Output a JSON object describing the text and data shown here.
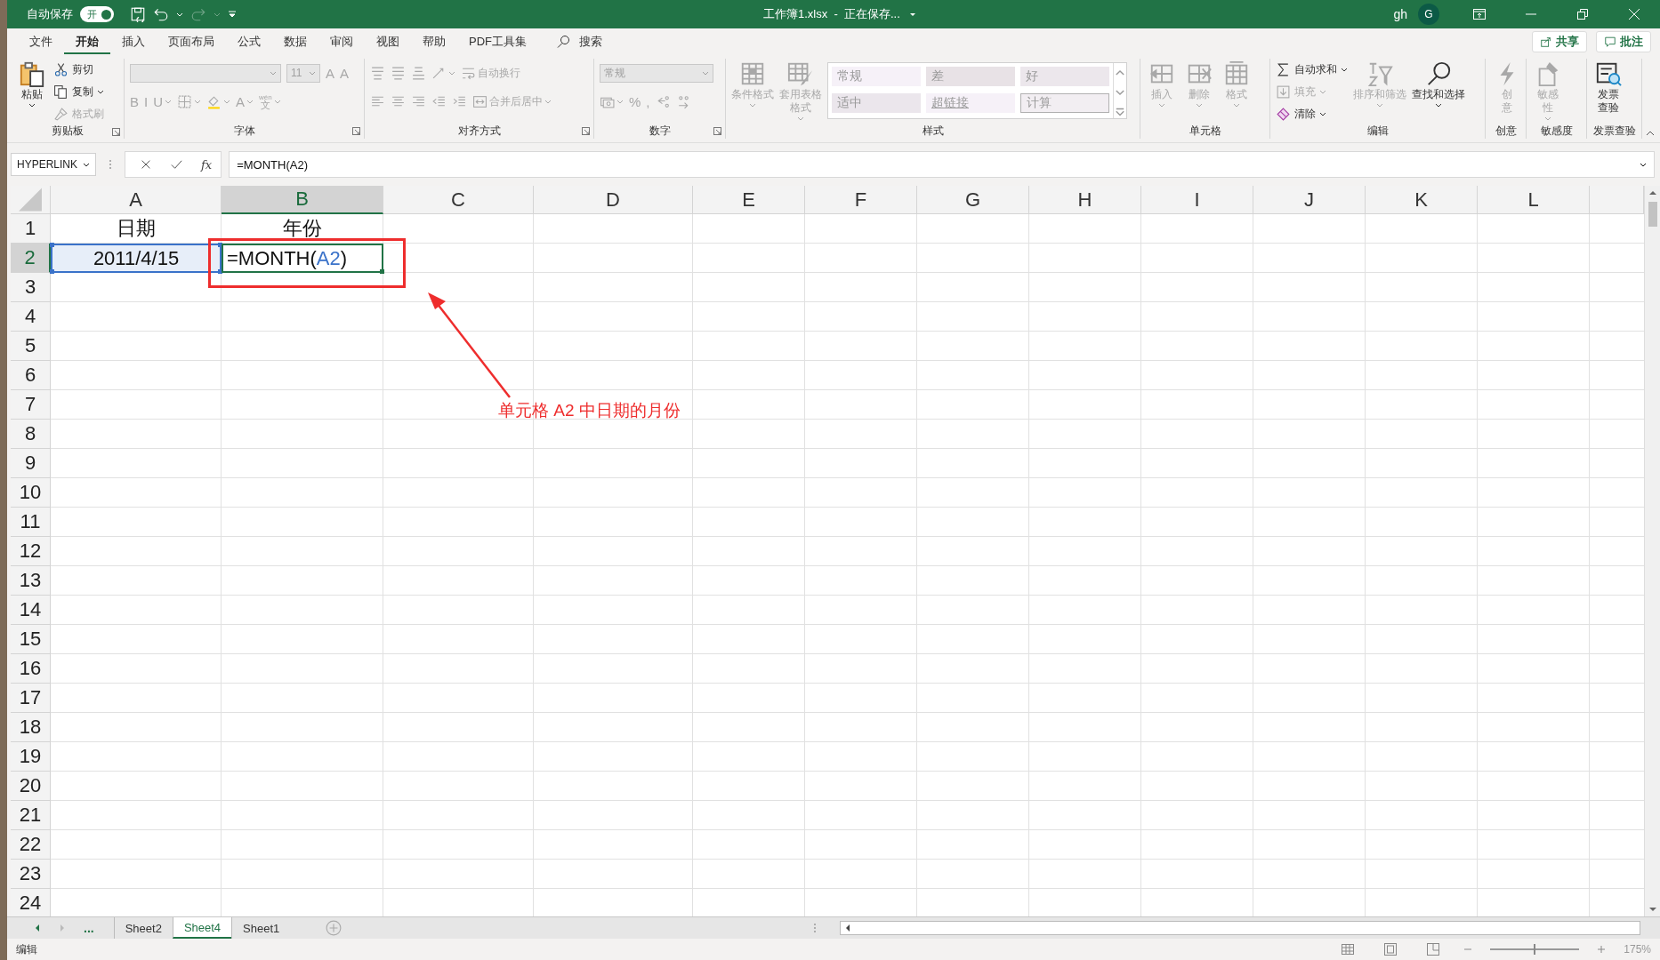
{
  "title_bar": {
    "autosave_label": "自动保存",
    "autosave_toggle": {
      "label": "开",
      "on": true
    },
    "redo_disabled": true,
    "title": "工作簿1.xlsx  -  正在保存...",
    "user": "gh",
    "avatar": "G"
  },
  "menu_tabs": [
    {
      "label": "文件",
      "selected": false
    },
    {
      "label": "开始",
      "selected": true
    },
    {
      "label": "插入",
      "selected": false
    },
    {
      "label": "页面布局",
      "selected": false
    },
    {
      "label": "公式",
      "selected": false
    },
    {
      "label": "数据",
      "selected": false
    },
    {
      "label": "审阅",
      "selected": false
    },
    {
      "label": "视图",
      "selected": false
    },
    {
      "label": "帮助",
      "selected": false
    },
    {
      "label": "PDF工具集",
      "selected": false
    }
  ],
  "search": {
    "label": "搜索"
  },
  "share_button": "共享",
  "comments_button": "批注",
  "ribbon": [
    {
      "label": "剪贴板",
      "launcher": true,
      "items": [
        {
          "kind": "large",
          "label": "粘贴",
          "disabled": false,
          "menu": true
        },
        {
          "kind": "stack",
          "rows": [
            {
              "kind": "button",
              "label": "剪切",
              "disabled": false,
              "menu": false
            },
            {
              "kind": "button",
              "label": "复制",
              "disabled": false,
              "menu": true
            },
            {
              "kind": "button",
              "label": "格式刷",
              "disabled": true,
              "menu": false
            }
          ]
        }
      ]
    },
    {
      "label": "字体",
      "launcher": true,
      "items": [
        {
          "kind": "stack",
          "rows": [
            {
              "kind": "tools",
              "tools": [
                {
                  "kind": "field",
                  "disabled": true
                },
                {
                  "kind": "field",
                  "value": "11",
                  "disabled": true
                },
                {
                  "kind": "text",
                  "text": "A",
                  "disabled": true,
                  "menu": false
                },
                {
                  "kind": "text",
                  "text": "A",
                  "disabled": true,
                  "menu": false
                }
              ]
            },
            {
              "kind": "tools",
              "tools": [
                {
                  "kind": "text",
                  "text": "B",
                  "disabled": true,
                  "menu": false
                },
                {
                  "kind": "text",
                  "text": "I",
                  "disabled": true,
                  "menu": false
                },
                {
                  "kind": "text",
                  "text": "U",
                  "disabled": true,
                  "menu": true
                },
                {
                  "kind": "icon",
                  "disabled": true,
                  "menu": true
                },
                {
                  "kind": "icon",
                  "disabled": true,
                  "menu": true
                },
                {
                  "kind": "text",
                  "text": "A",
                  "disabled": true,
                  "menu": true
                },
                {
                  "kind": "text",
                  "text": "文",
                  "ruby": "wén",
                  "disabled": true,
                  "menu": true
                }
              ]
            }
          ]
        }
      ]
    },
    {
      "label": "对齐方式",
      "launcher": true,
      "items": [
        {
          "kind": "stack",
          "rows": [
            {
              "kind": "tools",
              "tools": [
                {
                  "kind": "icon",
                  "disabled": true,
                  "menu": false
                },
                {
                  "kind": "icon",
                  "disabled": true,
                  "menu": false
                },
                {
                  "kind": "icon",
                  "disabled": true,
                  "menu": false
                },
                {
                  "kind": "icon",
                  "disabled": true,
                  "menu": true
                },
                {
                  "kind": "button",
                  "label": "自动换行",
                  "disabled": true,
                  "menu": false
                }
              ]
            },
            {
              "kind": "tools",
              "tools": [
                {
                  "kind": "icon",
                  "disabled": true,
                  "menu": false
                },
                {
                  "kind": "icon",
                  "disabled": true,
                  "menu": false
                },
                {
                  "kind": "icon",
                  "disabled": true,
                  "menu": false
                },
                {
                  "kind": "icon",
                  "disabled": true,
                  "menu": false
                },
                {
                  "kind": "icon",
                  "disabled": true,
                  "menu": false
                },
                {
                  "kind": "button",
                  "label": "合并后居中",
                  "disabled": true,
                  "menu": true
                }
              ]
            }
          ]
        }
      ]
    },
    {
      "label": "数字",
      "launcher": true,
      "items": [
        {
          "kind": "stack",
          "rows": [
            {
              "kind": "tools",
              "tools": [
                {
                  "kind": "field",
                  "value": "常规",
                  "disabled": true
                }
              ]
            },
            {
              "kind": "tools",
              "tools": [
                {
                  "kind": "icon",
                  "disabled": true,
                  "menu": true
                },
                {
                  "kind": "text",
                  "text": "%",
                  "disabled": true,
                  "menu": false
                },
                {
                  "kind": "text",
                  "text": ",",
                  "disabled": true,
                  "menu": false
                },
                {
                  "kind": "icon",
                  "disabled": true,
                  "menu": false
                },
                {
                  "kind": "icon",
                  "disabled": true,
                  "menu": false
                }
              ]
            }
          ]
        }
      ]
    },
    {
      "label": "样式",
      "launcher": false,
      "items": [
        {
          "kind": "large",
          "label": "条件格式",
          "disabled": true,
          "menu": true
        },
        {
          "kind": "large",
          "label": "套用表格格式",
          "disabled": true,
          "menu": true
        },
        {
          "kind": "gallery",
          "styles": [
            {
              "label": "常规",
              "kind": "normal"
            },
            {
              "label": "差",
              "kind": "bad"
            },
            {
              "label": "好",
              "kind": "good"
            },
            {
              "label": "适中",
              "kind": "neutral"
            },
            {
              "label": "超链接",
              "kind": "hyperlink"
            },
            {
              "label": "计算",
              "kind": "calculation"
            }
          ]
        }
      ]
    },
    {
      "label": "单元格",
      "launcher": false,
      "items": [
        {
          "kind": "large",
          "label": "插入",
          "disabled": true,
          "menu": true
        },
        {
          "kind": "large",
          "label": "删除",
          "disabled": true,
          "menu": true
        },
        {
          "kind": "large",
          "label": "格式",
          "disabled": true,
          "menu": true
        }
      ]
    },
    {
      "label": "编辑",
      "launcher": false,
      "items": [
        {
          "kind": "stack",
          "rows": [
            {
              "kind": "button",
              "label": "自动求和",
              "disabled": false,
              "menu": true
            },
            {
              "kind": "button",
              "label": "填充",
              "disabled": true,
              "menu": true
            },
            {
              "kind": "button",
              "label": "清除",
              "disabled": false,
              "menu": true
            }
          ]
        },
        {
          "kind": "large",
          "label": "排序和筛选",
          "disabled": true,
          "menu": true
        },
        {
          "kind": "large",
          "label": "查找和选择",
          "disabled": false,
          "menu": true
        }
      ]
    },
    {
      "label": "创意",
      "launcher": false,
      "items": [
        {
          "kind": "large",
          "label": "创意",
          "disabled": true,
          "menu": false
        }
      ]
    },
    {
      "label": "敏感度",
      "launcher": false,
      "items": [
        {
          "kind": "large",
          "label": "敏感性",
          "disabled": true,
          "menu": true
        }
      ]
    },
    {
      "label": "发票查验",
      "launcher": false,
      "items": [
        {
          "kind": "large",
          "label": "发票查验",
          "disabled": false,
          "menu": false
        }
      ]
    }
  ],
  "formula_bar": {
    "name_box": "HYPERLINK",
    "fx": "fx",
    "formula": "=MONTH(A2)"
  },
  "sheet": {
    "columns": [
      {
        "label": "A",
        "selected": false
      },
      {
        "label": "B",
        "selected": true
      },
      {
        "label": "C",
        "selected": false
      },
      {
        "label": "D",
        "selected": false
      },
      {
        "label": "E",
        "selected": false
      },
      {
        "label": "F",
        "selected": false
      },
      {
        "label": "G",
        "selected": false
      },
      {
        "label": "H",
        "selected": false
      },
      {
        "label": "I",
        "selected": false
      },
      {
        "label": "J",
        "selected": false
      },
      {
        "label": "K",
        "selected": false
      },
      {
        "label": "L",
        "selected": false
      }
    ],
    "rows": [
      {
        "number": "1",
        "selected": false,
        "cells": [
          {
            "kind": "plain",
            "text": "日期"
          },
          {
            "kind": "plain",
            "text": "年份"
          }
        ]
      },
      {
        "number": "2",
        "selected": true,
        "cells": [
          {
            "kind": "referenced",
            "text": "2011/4/15"
          },
          {
            "kind": "editing",
            "parts": [
              {
                "kind": "plain",
                "text": "=MONTH("
              },
              {
                "kind": "reference",
                "text": "A2"
              },
              {
                "kind": "plain",
                "text": ")"
              }
            ]
          }
        ]
      },
      {
        "number": "3",
        "selected": false
      },
      {
        "number": "4",
        "selected": false
      },
      {
        "number": "5",
        "selected": false
      },
      {
        "number": "6",
        "selected": false
      },
      {
        "number": "7",
        "selected": false
      },
      {
        "number": "8",
        "selected": false
      },
      {
        "number": "9",
        "selected": false
      },
      {
        "number": "10",
        "selected": false
      },
      {
        "number": "11",
        "selected": false
      },
      {
        "number": "12",
        "selected": false
      },
      {
        "number": "13",
        "selected": false
      },
      {
        "number": "14",
        "selected": false
      },
      {
        "number": "15",
        "selected": false
      },
      {
        "number": "16",
        "selected": false
      },
      {
        "number": "17",
        "selected": false
      },
      {
        "number": "18",
        "selected": false
      },
      {
        "number": "19",
        "selected": false
      },
      {
        "number": "20",
        "selected": false
      },
      {
        "number": "21",
        "selected": false
      },
      {
        "number": "22",
        "selected": false
      },
      {
        "number": "23",
        "selected": false
      },
      {
        "number": "24",
        "selected": false
      }
    ],
    "annotation": {
      "text": "单元格 A2 中日期的月份"
    }
  },
  "sheet_tabs": {
    "more": "...",
    "tabs": [
      {
        "label": "Sheet2",
        "selected": false
      },
      {
        "label": "Sheet4",
        "selected": true
      },
      {
        "label": "Sheet1",
        "selected": false
      }
    ]
  },
  "status_bar": {
    "mode": "编辑",
    "zoom": {
      "level": 0.5,
      "reading": "175%"
    }
  }
}
